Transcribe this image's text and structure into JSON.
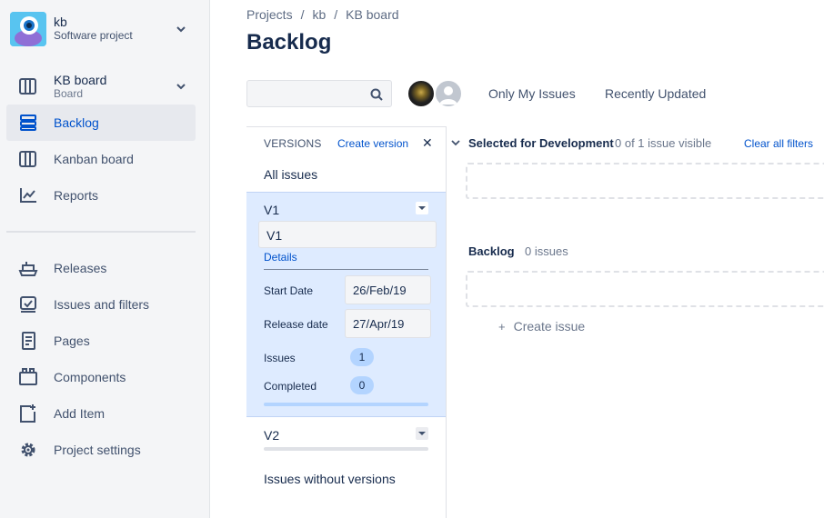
{
  "project": {
    "name": "kb",
    "type": "Software project"
  },
  "sidebar": {
    "board": {
      "name": "KB board",
      "sub": "Board"
    },
    "items_top": [
      {
        "label": "Backlog",
        "icon": "backlog-icon",
        "active": true
      },
      {
        "label": "Kanban board",
        "icon": "kanban-board-icon",
        "active": false
      },
      {
        "label": "Reports",
        "icon": "reports-icon",
        "active": false
      }
    ],
    "items_bottom": [
      {
        "label": "Releases",
        "icon": "releases-icon"
      },
      {
        "label": "Issues and filters",
        "icon": "issues-filters-icon"
      },
      {
        "label": "Pages",
        "icon": "pages-icon"
      },
      {
        "label": "Components",
        "icon": "components-icon"
      },
      {
        "label": "Add Item",
        "icon": "add-item-icon"
      },
      {
        "label": "Project settings",
        "icon": "gear-icon"
      }
    ]
  },
  "breadcrumbs": [
    "Projects",
    "/",
    "kb",
    "/",
    "KB board"
  ],
  "page_title": "Backlog",
  "filters": {
    "only_my_issues": "Only My Issues",
    "recently_updated": "Recently Updated"
  },
  "versions": {
    "header": "VERSIONS",
    "create": "Create version",
    "close": "✕",
    "all_issues": "All issues",
    "v1": {
      "name": "V1",
      "name_field": "V1",
      "details": "Details",
      "start_label": "Start Date",
      "start_value": "26/Feb/19",
      "release_label": "Release date",
      "release_value": "27/Apr/19",
      "issues_label": "Issues",
      "issues_count": "1",
      "completed_label": "Completed",
      "completed_count": "0"
    },
    "v2": {
      "name": "V2"
    },
    "without": "Issues without versions"
  },
  "selected_for_dev": {
    "title": "Selected for Development",
    "count": "0 of 1 issue visible",
    "clear": "Clear all filters"
  },
  "backlog": {
    "title": "Backlog",
    "count": "0 issues",
    "create": "Create issue",
    "plus": "+"
  },
  "colors": {
    "accent": "#0052cc",
    "selected_version_bg": "#deebff",
    "sidebar_bg": "#f4f5f7"
  }
}
